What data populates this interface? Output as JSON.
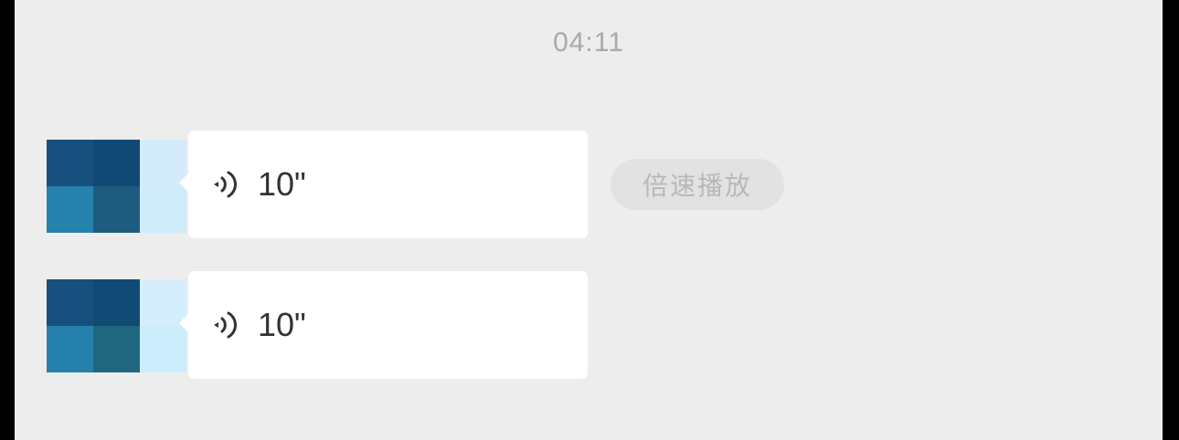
{
  "chat": {
    "timestamp": "04:11",
    "speed_play_label": "倍速播放",
    "messages": [
      {
        "duration": "10\"",
        "avatar_colors": [
          "#17507e",
          "#114874",
          "#d4ecfa",
          "#2582ac",
          "#1f5b7e",
          "#d0ecfa"
        ]
      },
      {
        "duration": "10\"",
        "avatar_colors": [
          "#17507e",
          "#124a76",
          "#d5eefc",
          "#2581ab",
          "#21667f",
          "#cceefc"
        ]
      }
    ]
  },
  "colors": {
    "background": "#ededed",
    "bubble": "#ffffff",
    "timestamp_text": "#a9a9a9",
    "pill_background": "#e2e2e2",
    "pill_text": "#b8b8b8"
  },
  "icons": {
    "voice": "voice-wave-icon",
    "avatar": "pixelated-avatar"
  }
}
